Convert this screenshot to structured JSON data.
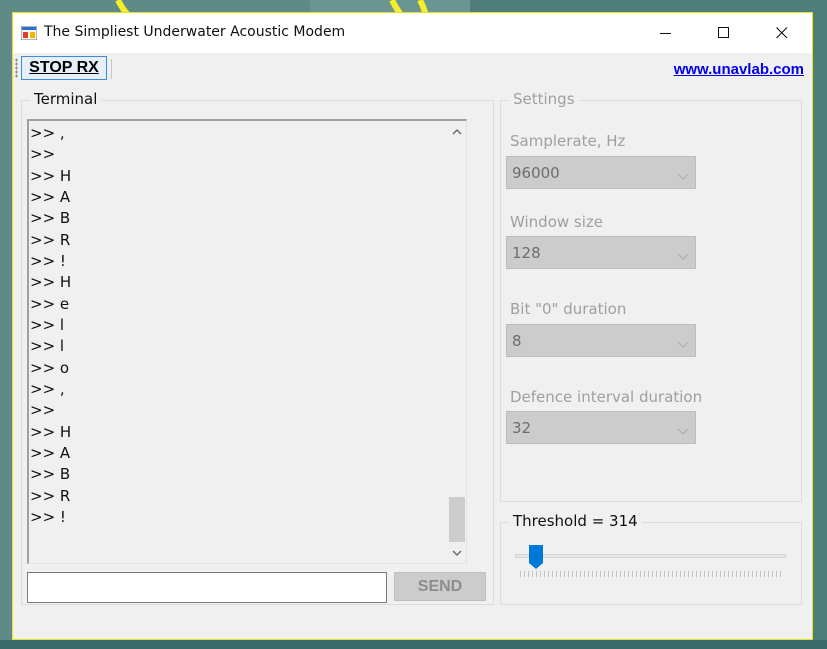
{
  "window": {
    "title": "The Simpliest Underwater Acoustic Modem",
    "controls": [
      "minimize-icon",
      "maximize-icon",
      "close-icon"
    ]
  },
  "toolbar": {
    "stop_label": "STOP RX",
    "link_text": "www.unavlab.com"
  },
  "terminal": {
    "label": "Terminal",
    "lines": [
      ">> ,",
      ">>",
      ">> H",
      ">> A",
      ">> B",
      ">> R",
      ">> !",
      ">> H",
      ">> e",
      ">> l",
      ">> l",
      ">> o",
      ">> ,",
      ">>",
      ">> H",
      ">> A",
      ">> B",
      ">> R",
      ">> !"
    ],
    "input_value": "",
    "send_label": "SEND"
  },
  "settings": {
    "label": "Settings",
    "samplerate_label": "Samplerate, Hz",
    "samplerate_value": "96000",
    "window_size_label": "Window size",
    "window_size_value": "128",
    "bit0_label": "Bit \"0\" duration",
    "bit0_value": "8",
    "defence_label": "Defence interval duration",
    "defence_value": "32"
  },
  "threshold": {
    "label": "Threshold = 314",
    "value": 314,
    "slider_fraction": 0.06
  },
  "colors": {
    "desktop": "#5f8a86",
    "window_border": "#e6e21e",
    "accent": "#0078d7",
    "link": "#0000ee"
  }
}
